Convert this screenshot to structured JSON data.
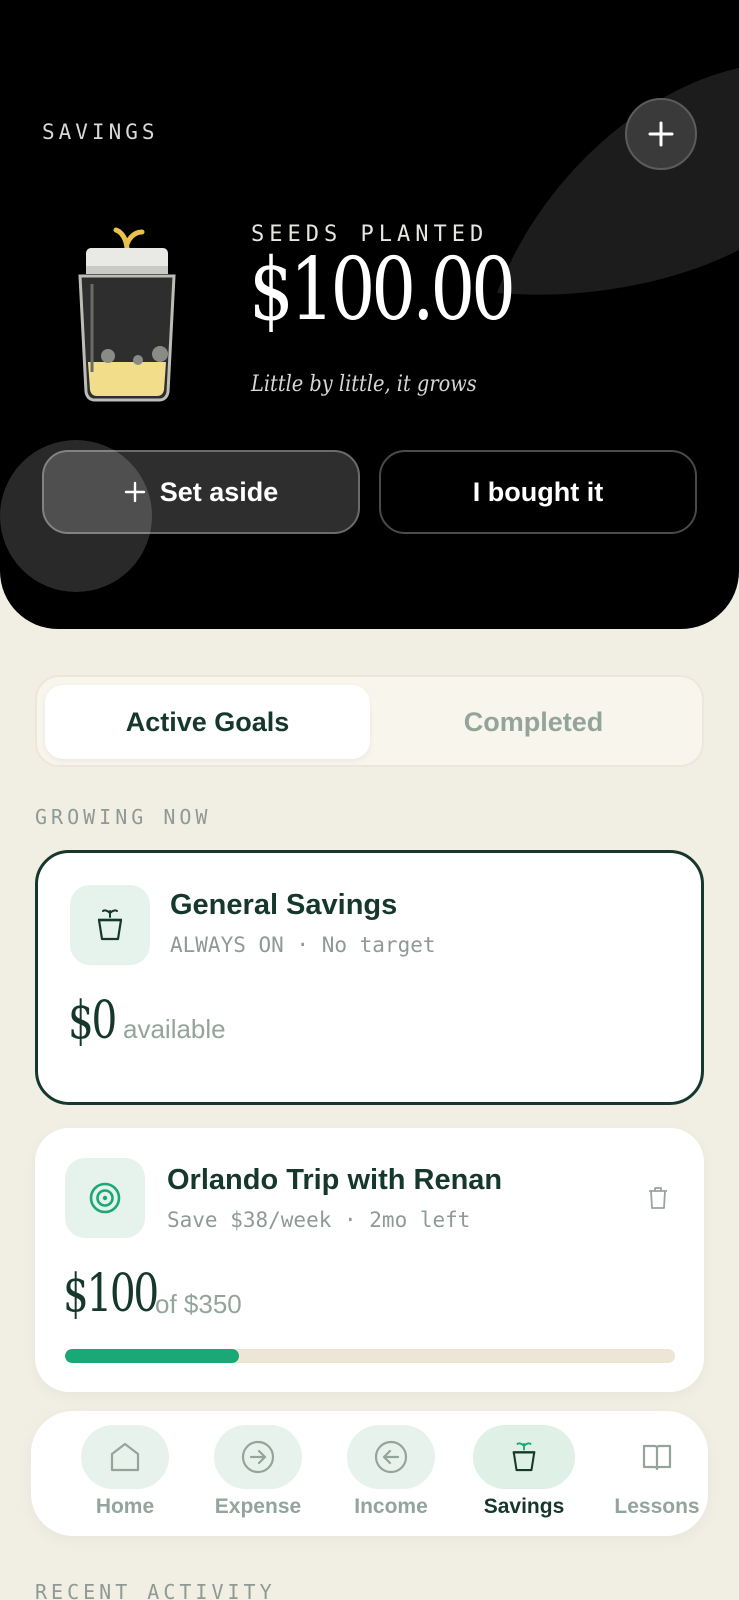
{
  "hero": {
    "section_label": "SAVINGS",
    "seeds_label": "SEEDS PLANTED",
    "seeds_amount": "$100.00",
    "tagline": "Little by little, it grows",
    "add_icon": "plus-icon",
    "set_aside_label": "Set aside",
    "bought_label": "I bought it"
  },
  "tabs": {
    "active": "Active Goals",
    "completed": "Completed"
  },
  "growing_label": "GROWING NOW",
  "goals": [
    {
      "title": "General Savings",
      "subtitle": "ALWAYS ON · No target",
      "amount": "$0",
      "suffix": "available",
      "icon": "jar-icon"
    },
    {
      "title": "Orlando Trip with Renan",
      "subtitle": "Save $38/week · 2mo left",
      "amount": "$100",
      "suffix": "of $350",
      "icon": "target-icon",
      "progress": 0.2857
    }
  ],
  "nav": [
    {
      "label": "Home",
      "icon": "home-icon"
    },
    {
      "label": "Expense",
      "icon": "arrow-right-circle-icon"
    },
    {
      "label": "Income",
      "icon": "arrow-left-circle-icon"
    },
    {
      "label": "Savings",
      "icon": "jar-icon",
      "active": true
    },
    {
      "label": "Lessons",
      "icon": "book-icon"
    }
  ],
  "recent_label": "RECENT ACTIVITY",
  "colors": {
    "primary": "#16382c",
    "accent": "#1aa876",
    "background": "#f1eee4",
    "muted": "#93a59b"
  }
}
